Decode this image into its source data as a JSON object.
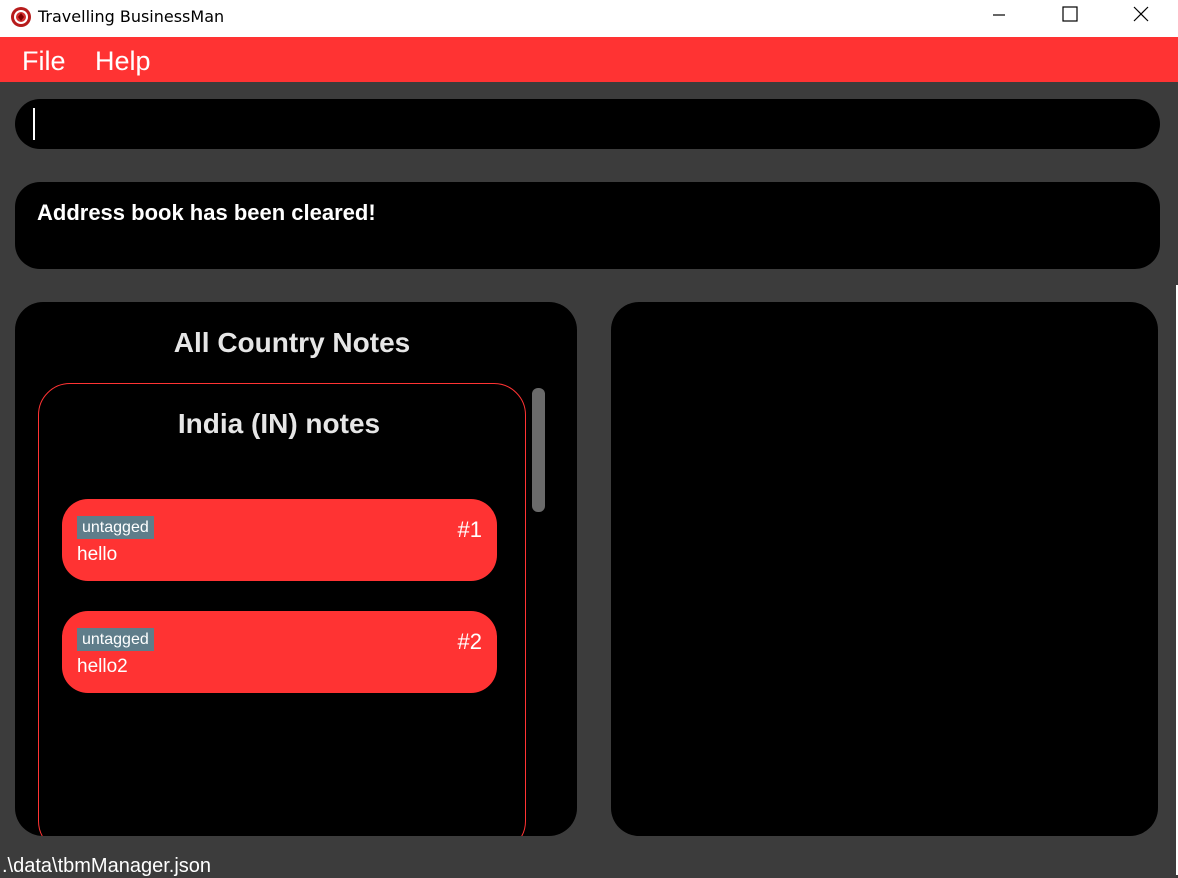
{
  "window": {
    "title": "Travelling BusinessMan",
    "app_icon": "app-logo-icon",
    "controls": [
      "minimize-icon",
      "maximize-icon",
      "close-icon"
    ]
  },
  "menu": {
    "file_label": "File",
    "help_label": "Help"
  },
  "command": {
    "value": "",
    "placeholder": ""
  },
  "result": {
    "message": "Address book has been cleared!"
  },
  "country_notes": {
    "title": "All Country Notes",
    "country_title": "India (IN) notes",
    "notes": [
      {
        "tag": "untagged",
        "index": "#1",
        "text": "hello"
      },
      {
        "tag": "untagged",
        "index": "#2",
        "text": "hello2"
      }
    ]
  },
  "status": {
    "file_path": ".\\data\\tbmManager.json"
  },
  "colors": {
    "accent": "#ff3333",
    "background": "#3c3c3c",
    "panel": "#000000",
    "tag": "#5f7d8a"
  }
}
